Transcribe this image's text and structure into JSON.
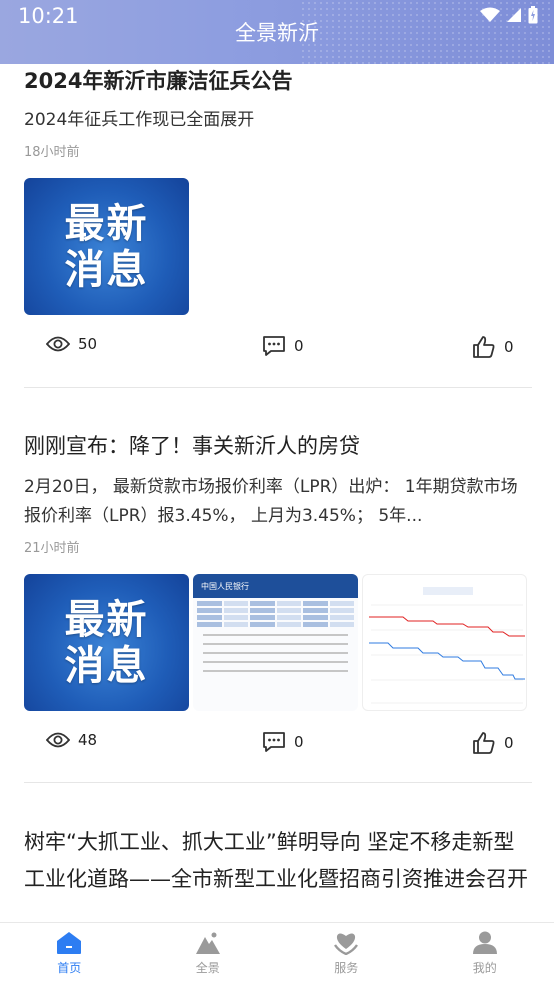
{
  "status": {
    "time": "10:21"
  },
  "header": {
    "title": "全景新沂"
  },
  "posts": [
    {
      "title": "2024年新沂市廉洁征兵公告",
      "summary": "2024年征兵工作现已全面展开",
      "time": "18小时前",
      "thumbs": [
        {
          "type": "news",
          "line1": "最新",
          "line2": "消息"
        }
      ],
      "views": "50",
      "comments": "0",
      "likes": "0"
    },
    {
      "title": "刚刚宣布：降了！事关新沂人的房贷",
      "summary": "2月20日，  最新贷款市场报价利率（LPR）出炉：  1年期贷款市场 报价利率（LPR）报3.45%，  上月为3.45%；  5年...",
      "time": "21小时前",
      "thumbs": [
        {
          "type": "news",
          "line1": "最新",
          "line2": "消息"
        },
        {
          "type": "doc",
          "header": "中国人民银行"
        },
        {
          "type": "chart"
        }
      ],
      "views": "48",
      "comments": "0",
      "likes": "0"
    },
    {
      "title": "树牢“大抓工业、抓大工业”鲜明导向 坚定不移走新型工业化道路——全市新型工业化暨招商引资推进会召开"
    }
  ],
  "nav": [
    {
      "label": "首页",
      "icon": "home-icon",
      "active": true
    },
    {
      "label": "全景",
      "icon": "mountain-icon",
      "active": false
    },
    {
      "label": "服务",
      "icon": "service-heart-icon",
      "active": false
    },
    {
      "label": "我的",
      "icon": "user-icon",
      "active": false
    }
  ],
  "colors": {
    "accent": "#2d7df2",
    "header": "#8e9ee0"
  }
}
